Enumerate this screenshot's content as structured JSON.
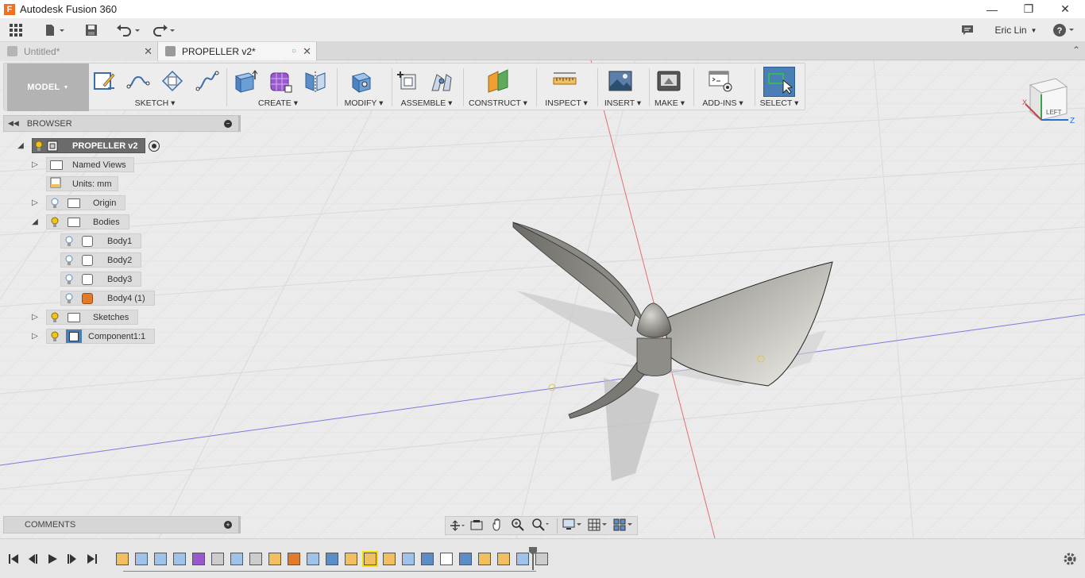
{
  "window": {
    "title": "Autodesk Fusion 360",
    "app_icon_letter": "F"
  },
  "appbar": {
    "user_name": "Eric Lin"
  },
  "tabs": [
    {
      "label": "Untitled*",
      "active": false
    },
    {
      "label": "PROPELLER v2*",
      "active": true
    }
  ],
  "toolbar": {
    "workspace": "MODEL",
    "groups": [
      {
        "label": "SKETCH",
        "icons": [
          "create-sketch-icon",
          "arc-icon",
          "rectangle-icon",
          "spline-icon"
        ]
      },
      {
        "label": "CREATE",
        "icons": [
          "extrude-icon",
          "create-form-icon",
          "mirror-icon"
        ]
      },
      {
        "label": "MODIFY",
        "icons": [
          "press-pull-icon"
        ]
      },
      {
        "label": "ASSEMBLE",
        "icons": [
          "new-component-icon",
          "joint-icon"
        ]
      },
      {
        "label": "CONSTRUCT",
        "icons": [
          "offset-plane-icon"
        ]
      },
      {
        "label": "INSPECT",
        "icons": [
          "measure-icon"
        ]
      },
      {
        "label": "INSERT",
        "icons": [
          "insert-image-icon"
        ]
      },
      {
        "label": "MAKE",
        "icons": [
          "3d-print-icon"
        ]
      },
      {
        "label": "ADD-INS",
        "icons": [
          "scripts-addins-icon"
        ]
      },
      {
        "label": "SELECT",
        "icons": [
          "select-icon"
        ]
      }
    ]
  },
  "browser": {
    "header": "BROWSER",
    "root": "PROPELLER v2",
    "items": [
      {
        "label": "Named Views"
      },
      {
        "label": "Units: mm"
      },
      {
        "label": "Origin"
      },
      {
        "label": "Bodies"
      },
      {
        "label": "Body1"
      },
      {
        "label": "Body2"
      },
      {
        "label": "Body3"
      },
      {
        "label": "Body4 (1)"
      },
      {
        "label": "Sketches"
      },
      {
        "label": "Component1:1"
      }
    ]
  },
  "viewcube": {
    "face_label": "LEFT",
    "axis_x": "X",
    "axis_z": "Z"
  },
  "comments": {
    "header": "COMMENTS"
  },
  "colors": {
    "accent": "#4a7fb5",
    "body_orange": "#e07b2e",
    "bulb_yellow": "#f0c419",
    "bulb_blue": "#5b8ec9"
  }
}
